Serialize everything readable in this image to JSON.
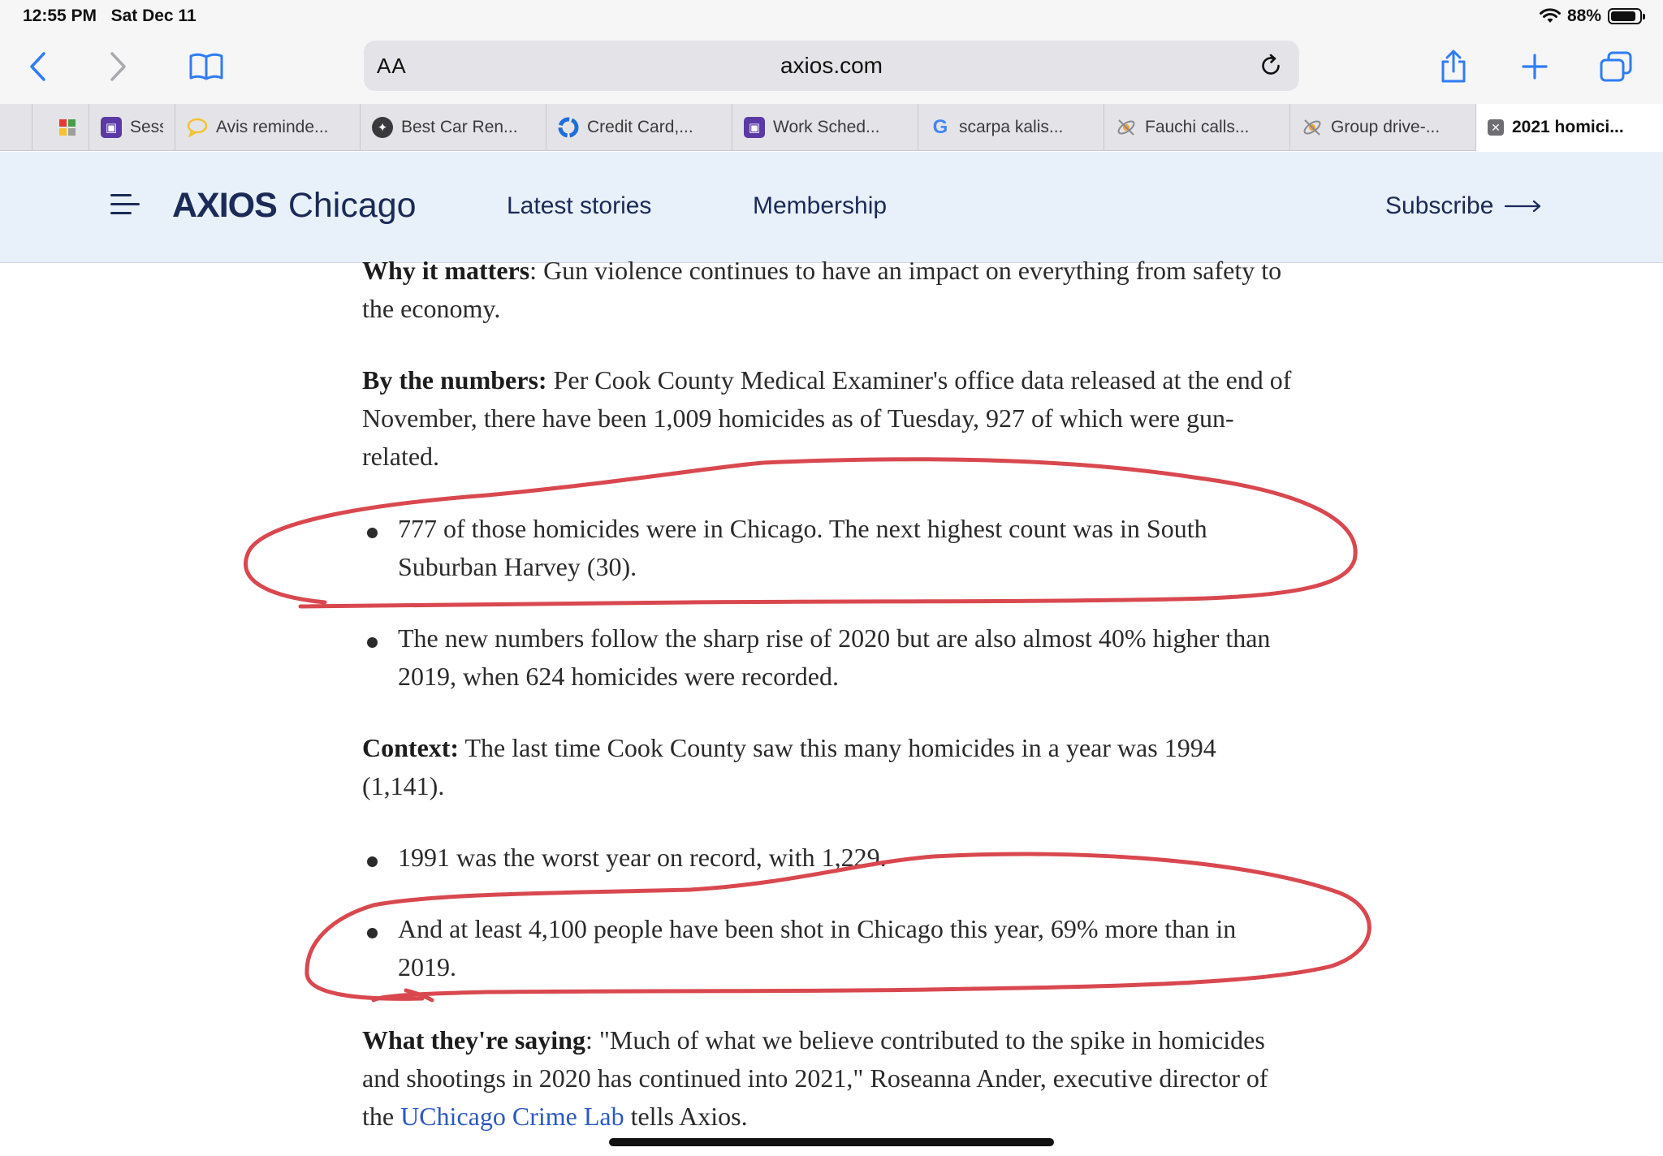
{
  "status_bar": {
    "time": "12:55 PM",
    "date": "Sat Dec 11",
    "battery": "88%",
    "battery_level": 0.88
  },
  "toolbar": {
    "reader_label": "AA",
    "url": "axios.com",
    "icons": [
      "back-icon",
      "forward-icon",
      "bookmarks-icon",
      "reload-icon",
      "share-icon",
      "new-tab-icon",
      "tabs-overview-icon"
    ]
  },
  "tabs": [
    {
      "label": "",
      "icon": "grid-favicon",
      "color": "#e53935"
    },
    {
      "label": "Sessi",
      "icon": "scheduler-favicon",
      "color": "#5b3aa5"
    },
    {
      "label": "Avis reminde...",
      "icon": "chat-bubble-favicon",
      "color": "#f2c230"
    },
    {
      "label": "Best Car Ren...",
      "icon": "shield-favicon",
      "color": "#3a3a3c"
    },
    {
      "label": "Credit Card,...",
      "icon": "loop-favicon",
      "color": "#1e6fd9"
    },
    {
      "label": "Work Sched...",
      "icon": "scheduler-favicon",
      "color": "#5b3aa5"
    },
    {
      "label": "scarpa kalis...",
      "icon": "google-favicon",
      "color": "#4285f4"
    },
    {
      "label": "Fauchi calls...",
      "icon": "satellite-favicon",
      "color": "#8a8a8e"
    },
    {
      "label": "Group drive-...",
      "icon": "satellite-favicon",
      "color": "#8a8a8e"
    },
    {
      "label": "2021 homici...",
      "icon": "close-tab-favicon",
      "color": "#6e6e73",
      "active": true
    }
  ],
  "site_header": {
    "logo_brand": "AXIOS",
    "logo_city": "Chicago",
    "nav": [
      "Latest stories",
      "Membership"
    ],
    "subscribe": "Subscribe"
  },
  "article": {
    "why_lead": "Why it matters",
    "why_body": ": Gun violence continues to have an impact on everything from safety to the economy.",
    "numbers_lead": "By the numbers:",
    "numbers_body": " Per Cook County Medical Examiner's office data released at the end of November, there have been 1,009 homicides as of Tuesday, 927 of which were gun-related.",
    "bullet_1": "777 of those homicides were in Chicago. The next highest count was in South Suburban Harvey (30).",
    "bullet_2": "The new numbers follow the sharp rise of 2020 but are also almost 40% higher than 2019, when 624 homicides were recorded.",
    "context_lead": "Context:",
    "context_body": " The last time Cook County saw this many homicides in a year was 1994 (1,141).",
    "bullet_3": "1991 was the worst year on record, with 1,229.",
    "bullet_4": "And at least 4,100 people have been shot in Chicago this year, 69% more than in 2019.",
    "saying_lead": "What they're saying",
    "saying_body_1": ": \"Much of what we believe contributed to the spike in homicides and shootings in 2020 has continued into 2021,\" Roseanna Ander, executive director of the ",
    "saying_link": "UChicago Crime Lab",
    "saying_body_2": " tells Axios."
  },
  "colors": {
    "accent_blue": "#2f7cf6",
    "axios_navy": "#1b2a57",
    "header_bg": "#e8f0fa",
    "annotation_red": "#d9484f",
    "link_blue": "#2b59c3"
  }
}
